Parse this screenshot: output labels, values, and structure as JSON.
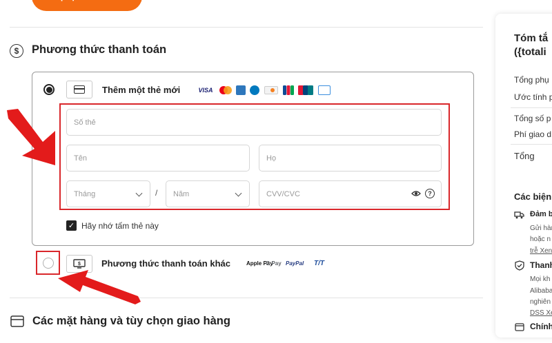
{
  "top_button": {
    "label": "Tiếp tục thanh toán"
  },
  "payment_section": {
    "title": "Phương thức thanh toán",
    "new_card": {
      "label": "Thêm một thẻ mới",
      "brands": [
        "VISA",
        "Mastercard",
        "Amex",
        "Diners",
        "Discover",
        "JCB",
        "UnionPay",
        "Cartes"
      ],
      "fields": {
        "card_number": "Số thẻ",
        "first_name": "Tên",
        "last_name": "Họ",
        "month": "Tháng",
        "year": "Năm",
        "cvv": "CVV/CVC",
        "separator": "/"
      },
      "remember_label": "Hãy nhớ tấm thẻ này"
    },
    "other_method": {
      "label": "Phương thức thanh toán khác",
      "brands": [
        "Apple Pay",
        "G Pay",
        "PayPal",
        "T/T"
      ]
    }
  },
  "items_section": {
    "title": "Các mặt hàng và tùy chọn giao hàng"
  },
  "summary": {
    "title_line1": "Tóm tắ",
    "title_line2": "({totali",
    "rows": [
      "Tổng phụ",
      "Ước tính p",
      "Tổng số p",
      "Phí giao d"
    ],
    "total": "Tổng",
    "benefits_title": "Các biện",
    "benefit1_title": "Đảm b",
    "benefit1_lines": [
      "Gửi hàn",
      "hoặc n",
      "trễ Xen"
    ],
    "benefit2_title": "Thanh",
    "benefit2_lines": [
      "Mọi kh",
      "Alibaba",
      "nghiên",
      "DSS Xe"
    ],
    "benefit3_title": "Chính"
  },
  "colors": {
    "accent": "#f46c12",
    "annotation": "#d9262a"
  }
}
